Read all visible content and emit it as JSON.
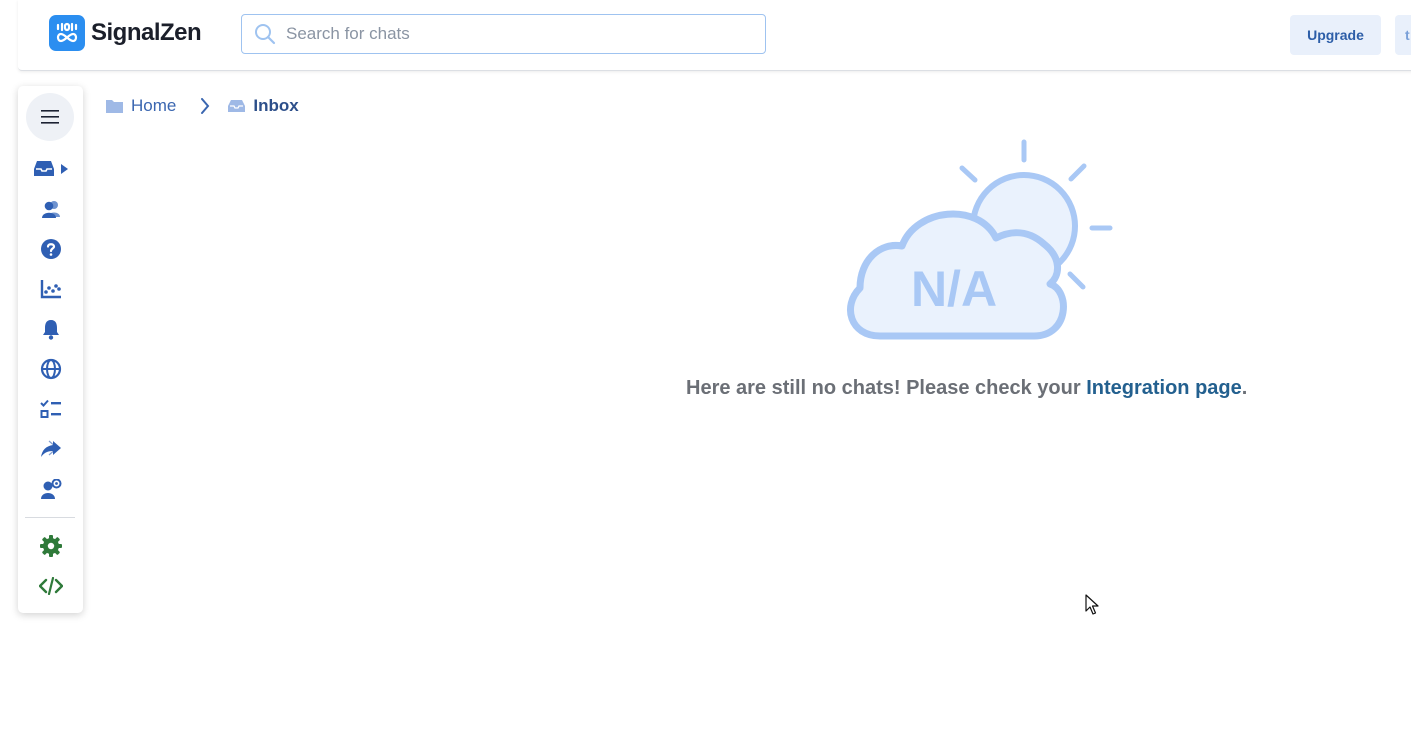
{
  "app": {
    "name": "SignalZen",
    "brand_color": "#2b8ef0",
    "accent_color": "#2d5ea8"
  },
  "search": {
    "placeholder": "Search for chats",
    "value": ""
  },
  "header": {
    "upgrade_label": "Upgrade",
    "extra_label": "t"
  },
  "sidebar": {
    "items": [
      {
        "name": "inbox",
        "icon": "inbox-icon",
        "active": true
      },
      {
        "name": "contacts",
        "icon": "users-icon"
      },
      {
        "name": "help",
        "icon": "question-icon"
      },
      {
        "name": "analytics",
        "icon": "chart-icon"
      },
      {
        "name": "notifications",
        "icon": "bell-icon"
      },
      {
        "name": "websites",
        "icon": "globe-icon"
      },
      {
        "name": "tasks",
        "icon": "checklist-icon"
      },
      {
        "name": "forwarding",
        "icon": "share-icon"
      },
      {
        "name": "agent-settings",
        "icon": "user-cog-icon"
      },
      {
        "name": "settings",
        "icon": "gear-icon"
      },
      {
        "name": "integration",
        "icon": "code-icon"
      }
    ]
  },
  "breadcrumb": {
    "home": "Home",
    "current": "Inbox"
  },
  "empty_state": {
    "illustration_text": "N/A",
    "message_prefix": "Here are still no chats! Please check your ",
    "link_text": "Integration page",
    "message_suffix": "."
  }
}
